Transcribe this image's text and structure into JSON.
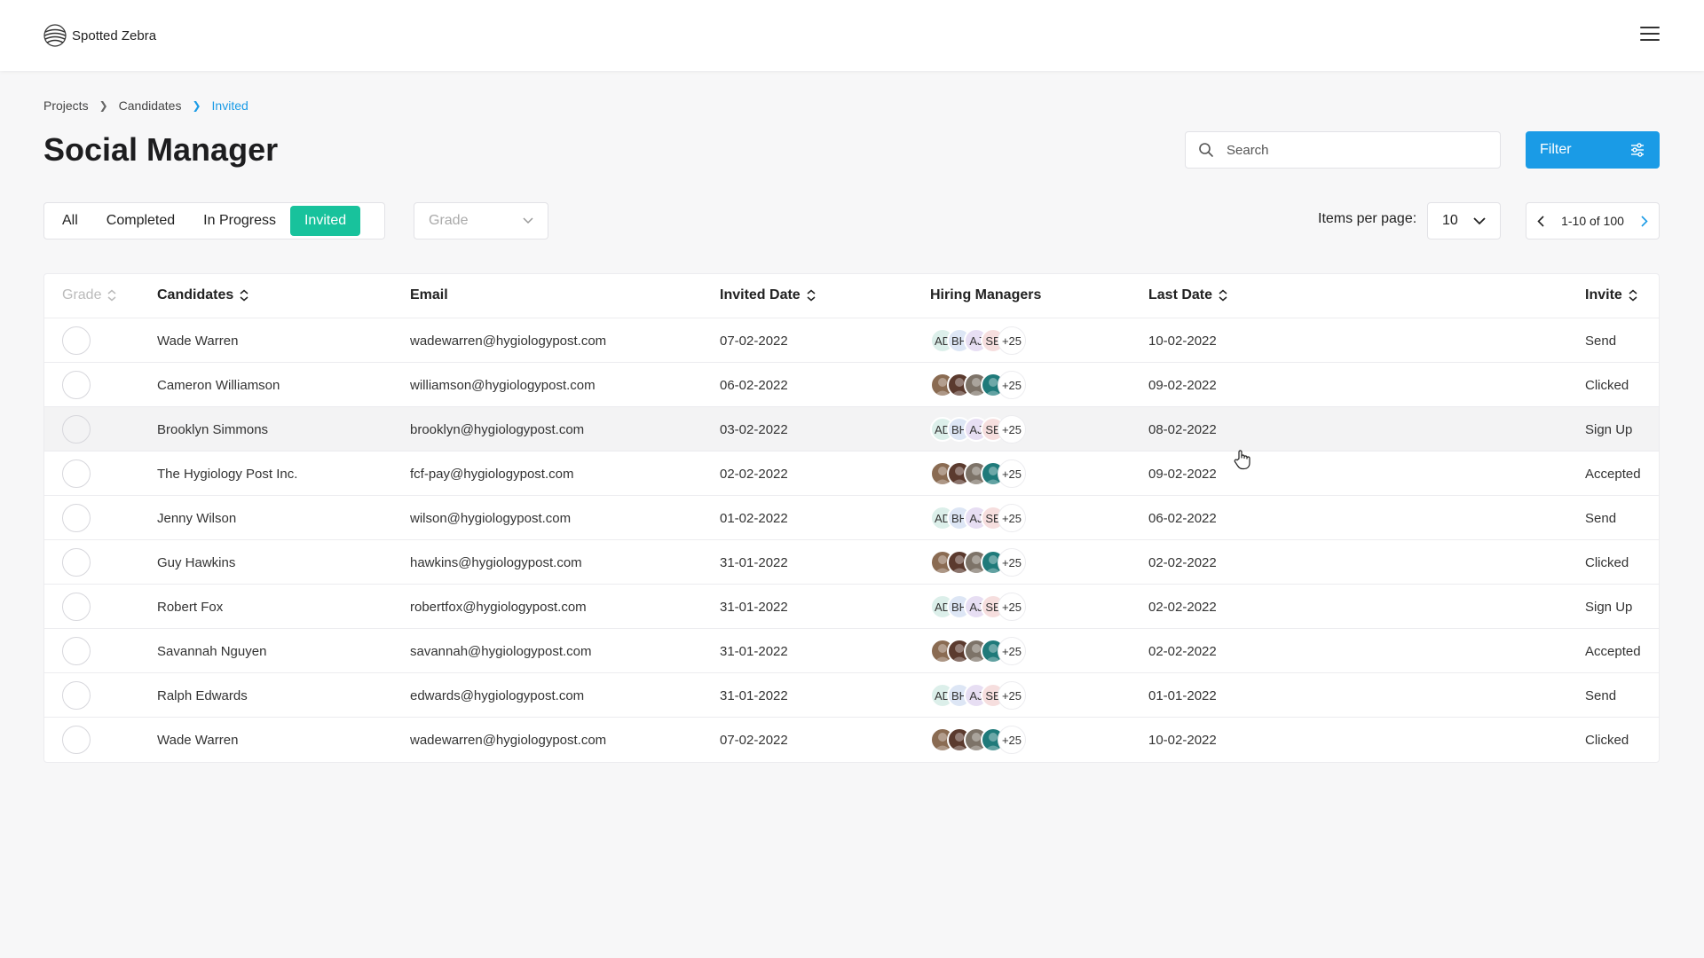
{
  "app": {
    "name": "Spotted Zebra"
  },
  "breadcrumb": [
    "Projects",
    "Candidates",
    "Invited"
  ],
  "page_title": "Social Manager",
  "search": {
    "placeholder": "Search",
    "value": ""
  },
  "filter_label": "Filter",
  "tabs": [
    {
      "label": "All",
      "active": false
    },
    {
      "label": "Completed",
      "active": false
    },
    {
      "label": "In Progress",
      "active": false
    },
    {
      "label": "Invited",
      "active": true
    }
  ],
  "grade_select": {
    "placeholder": "Grade"
  },
  "items_per_page": {
    "label": "Items per page:",
    "value": "10"
  },
  "pagination": {
    "text": "1-10 of 100"
  },
  "table": {
    "columns": {
      "grade": "Grade",
      "candidates": "Candidates",
      "email": "Email",
      "invited_date": "Invited Date",
      "hiring_managers": "Hiring Managers",
      "last_date": "Last Date",
      "invite": "Invite"
    },
    "manager_initials": [
      "AD",
      "BH",
      "AJ",
      "SE"
    ],
    "manager_more": "+25",
    "rows": [
      {
        "name": "Wade Warren",
        "email": "wadewarren@hygiologypost.com",
        "invited": "07-02-2022",
        "last": "10-02-2022",
        "invite": "Send",
        "managers": "initials"
      },
      {
        "name": "Cameron Williamson",
        "email": "williamson@hygiologypost.com",
        "invited": "06-02-2022",
        "last": "09-02-2022",
        "invite": "Clicked",
        "managers": "photos"
      },
      {
        "name": "Brooklyn Simmons",
        "email": "brooklyn@hygiologypost.com",
        "invited": "03-02-2022",
        "last": "08-02-2022",
        "invite": "Sign Up",
        "managers": "initials"
      },
      {
        "name": "The Hygiology Post Inc.",
        "email": "fcf-pay@hygiologypost.com",
        "invited": "02-02-2022",
        "last": "09-02-2022",
        "invite": "Accepted",
        "managers": "photos"
      },
      {
        "name": "Jenny Wilson",
        "email": "wilson@hygiologypost.com",
        "invited": "01-02-2022",
        "last": "06-02-2022",
        "invite": "Send",
        "managers": "initials"
      },
      {
        "name": "Guy Hawkins",
        "email": "hawkins@hygiologypost.com",
        "invited": "31-01-2022",
        "last": "02-02-2022",
        "invite": "Clicked",
        "managers": "photos"
      },
      {
        "name": "Robert Fox",
        "email": "robertfox@hygiologypost.com",
        "invited": "31-01-2022",
        "last": "02-02-2022",
        "invite": "Sign Up",
        "managers": "initials"
      },
      {
        "name": "Savannah Nguyen",
        "email": "savannah@hygiologypost.com",
        "invited": "31-01-2022",
        "last": "02-02-2022",
        "invite": "Accepted",
        "managers": "photos"
      },
      {
        "name": "Ralph Edwards",
        "email": "edwards@hygiologypost.com",
        "invited": "31-01-2022",
        "last": "01-01-2022",
        "invite": "Send",
        "managers": "initials"
      },
      {
        "name": "Wade Warren",
        "email": "wadewarren@hygiologypost.com",
        "invited": "07-02-2022",
        "last": "10-02-2022",
        "invite": "Clicked",
        "managers": "photos"
      }
    ]
  },
  "colors": {
    "accent_blue": "#1a9be6",
    "active_tab_green": "#18c29c",
    "initial_avatar_bgs": [
      "#dcefea",
      "#dde6f5",
      "#e7def3",
      "#f6dede"
    ],
    "photo_avatar_bgs": [
      "#8a6b52",
      "#5b3a2e",
      "#7d7368",
      "#1f7a7a"
    ]
  }
}
